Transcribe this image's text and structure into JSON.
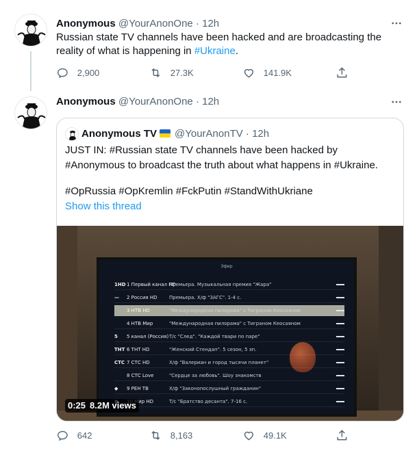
{
  "tweet1": {
    "name": "Anonymous",
    "handle": "@YourAnonOne",
    "separator": "·",
    "time": "12h",
    "text_main": "Russian state TV channels have been hacked and are broadcasting the reality of what is happening in ",
    "text_hashtag": "#Ukraine",
    "text_end": ".",
    "replies": "2,900",
    "retweets": "27.3K",
    "likes": "141.9K"
  },
  "tweet2": {
    "name": "Anonymous",
    "handle": "@YourAnonOne",
    "separator": "·",
    "time": "12h",
    "replies": "642",
    "retweets": "8,163",
    "likes": "49.1K"
  },
  "quote": {
    "name": "Anonymous TV",
    "handle": "@YourAnonTV",
    "separator": "·",
    "time": "12h",
    "line1": "JUST IN: #Russian state TV channels have been hacked by",
    "line2": "#Anonymous to broadcast the truth about what happens in #Ukraine.",
    "line3": "#OpRussia #OpKremlin #FckPutin #StandWithUkriane",
    "show_thread": "Show this thread",
    "video_time": "0:25",
    "video_views": "8.2M views"
  },
  "tv": {
    "title": "Эфир",
    "channels": [
      {
        "logo": "1HD",
        "name": "1 Первый канал HD",
        "program": "Премьера. Музыкальная премия \"Жара\""
      },
      {
        "logo": "—",
        "name": "2 Россия HD",
        "program": "Премьера. Х/ф \"ЗАГС\". 1-4 с."
      },
      {
        "logo": "",
        "name": "3 НТВ HD",
        "program": "\"Международная пилорама\" с Тиграном Кеосаяном"
      },
      {
        "logo": "",
        "name": "4 НТВ Мир",
        "program": "\"Международная пилорама\" с Тиграном Кеосаяном"
      },
      {
        "logo": "5",
        "name": "5 канал (Россия)",
        "program": "Т/с \"След\". \"Каждой твари по паре\""
      },
      {
        "logo": "ТНТ",
        "name": "6 ТНТ HD",
        "program": "\"Женский Стендап\". 5 сезон, 5 эп."
      },
      {
        "logo": "СТС",
        "name": "7 СТС HD",
        "program": "Х/ф \"Валериан и город тысячи планет\""
      },
      {
        "logo": "",
        "name": "8 СТС Love",
        "program": "\"Сердце за любовь\". Шоу знакомств"
      },
      {
        "logo": "◆",
        "name": "9 РЕН ТВ",
        "program": "Х/ф \"Законопослушный гражданин\""
      },
      {
        "logo": "●",
        "name": "10 Мир HD",
        "program": "Т/с \"Братство десанта\". 7-16 с."
      }
    ]
  },
  "icons": {
    "reply": "reply-icon",
    "retweet": "retweet-icon",
    "like": "heart-icon",
    "share": "share-icon",
    "more": "more-icon"
  },
  "colors": {
    "link": "#1d9bf0",
    "secondary": "#536471",
    "border": "#cfd9de",
    "flag_blue": "#1e64c8",
    "flag_yellow": "#ffd500"
  }
}
